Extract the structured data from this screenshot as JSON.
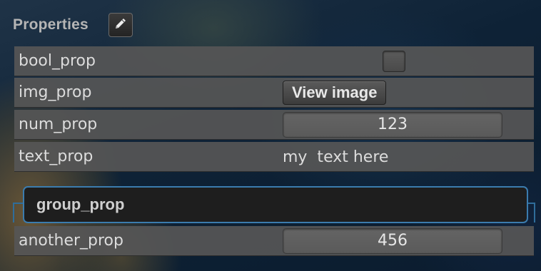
{
  "panel": {
    "title": "Properties",
    "edit_icon": "pencil-icon"
  },
  "properties": [
    {
      "name": "bool_prop",
      "type": "checkbox",
      "checked": false
    },
    {
      "name": "img_prop",
      "type": "button",
      "button_label": "View image"
    },
    {
      "name": "num_prop",
      "type": "number",
      "value": "123"
    },
    {
      "name": "text_prop",
      "type": "text",
      "value": "my  text here"
    }
  ],
  "group": {
    "name": "group_prop",
    "accent_color": "#3b7cae",
    "properties": [
      {
        "name": "another_prop",
        "type": "number",
        "value": "456"
      }
    ]
  }
}
